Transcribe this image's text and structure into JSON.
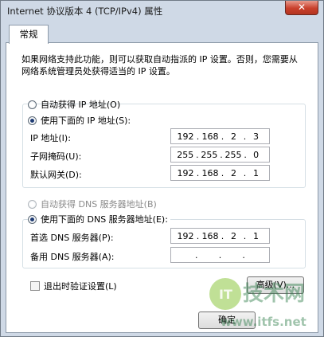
{
  "window": {
    "title": "Internet 协议版本 4 (TCP/IPv4) 属性",
    "close_label": "✕"
  },
  "tabs": [
    {
      "label": "常规",
      "active": true
    }
  ],
  "description": "如果网络支持此功能，则可以获取自动指派的 IP 设置。否则，您需要从网络系统管理员处获得适当的 IP 设置。",
  "ip_settings": {
    "auto_ip_label": "自动获得 IP 地址(O)",
    "auto_ip_selected": false,
    "manual_ip_label": "使用下面的 IP 地址(S):",
    "manual_ip_selected": true,
    "fields": [
      {
        "label": "IP 地址(I):",
        "octets": [
          "192",
          "168",
          "2",
          "3"
        ]
      },
      {
        "label": "子网掩码(U):",
        "octets": [
          "255",
          "255",
          "255",
          "0"
        ]
      },
      {
        "label": "默认网关(D):",
        "octets": [
          "192",
          "168",
          "2",
          "1"
        ]
      }
    ]
  },
  "dns_settings": {
    "auto_dns_label": "自动获得 DNS 服务器地址(B)",
    "auto_dns_enabled": false,
    "manual_dns_label": "使用下面的 DNS 服务器地址(E):",
    "manual_dns_selected": true,
    "fields": [
      {
        "label": "首选 DNS 服务器(P):",
        "octets": [
          "192",
          "168",
          "2",
          "1"
        ]
      },
      {
        "label": "备用 DNS 服务器(A):",
        "octets": [
          "",
          "",
          "",
          ""
        ]
      }
    ]
  },
  "validate_on_exit": {
    "label": "退出时验证设置(L)",
    "checked": false
  },
  "buttons": {
    "advanced_label": "高级(V)...",
    "ok_label": "确定"
  },
  "watermark": {
    "text_main": "技术网",
    "text_url": "www.itfs.net"
  }
}
